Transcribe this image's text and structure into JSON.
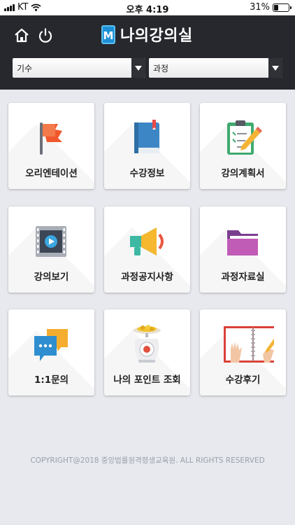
{
  "status_bar": {
    "carrier": "KT",
    "time": "오후 4:19",
    "battery": "31%"
  },
  "header": {
    "title": "나의강의실",
    "logo_letter": "M",
    "term_select": "기수",
    "course_select": "과정"
  },
  "menu": [
    {
      "label": "오리엔테이션",
      "icon": "flag-icon"
    },
    {
      "label": "수강정보",
      "icon": "book-icon"
    },
    {
      "label": "강의계획서",
      "icon": "clipboard-pencil-icon"
    },
    {
      "label": "강의보기",
      "icon": "video-film-icon"
    },
    {
      "label": "과정공지사항",
      "icon": "megaphone-icon"
    },
    {
      "label": "과정자료실",
      "icon": "folder-icon"
    },
    {
      "label": "1:1문의",
      "icon": "chat-bubbles-icon"
    },
    {
      "label": "나의 포인트 조회",
      "icon": "scale-coins-icon"
    },
    {
      "label": "수강후기",
      "icon": "notebook-hand-icon"
    }
  ],
  "footer": {
    "copyright": "COPYRIGHT@2018 중앙법률원격평생교육원. ALL RIGHTS RESERVED"
  }
}
